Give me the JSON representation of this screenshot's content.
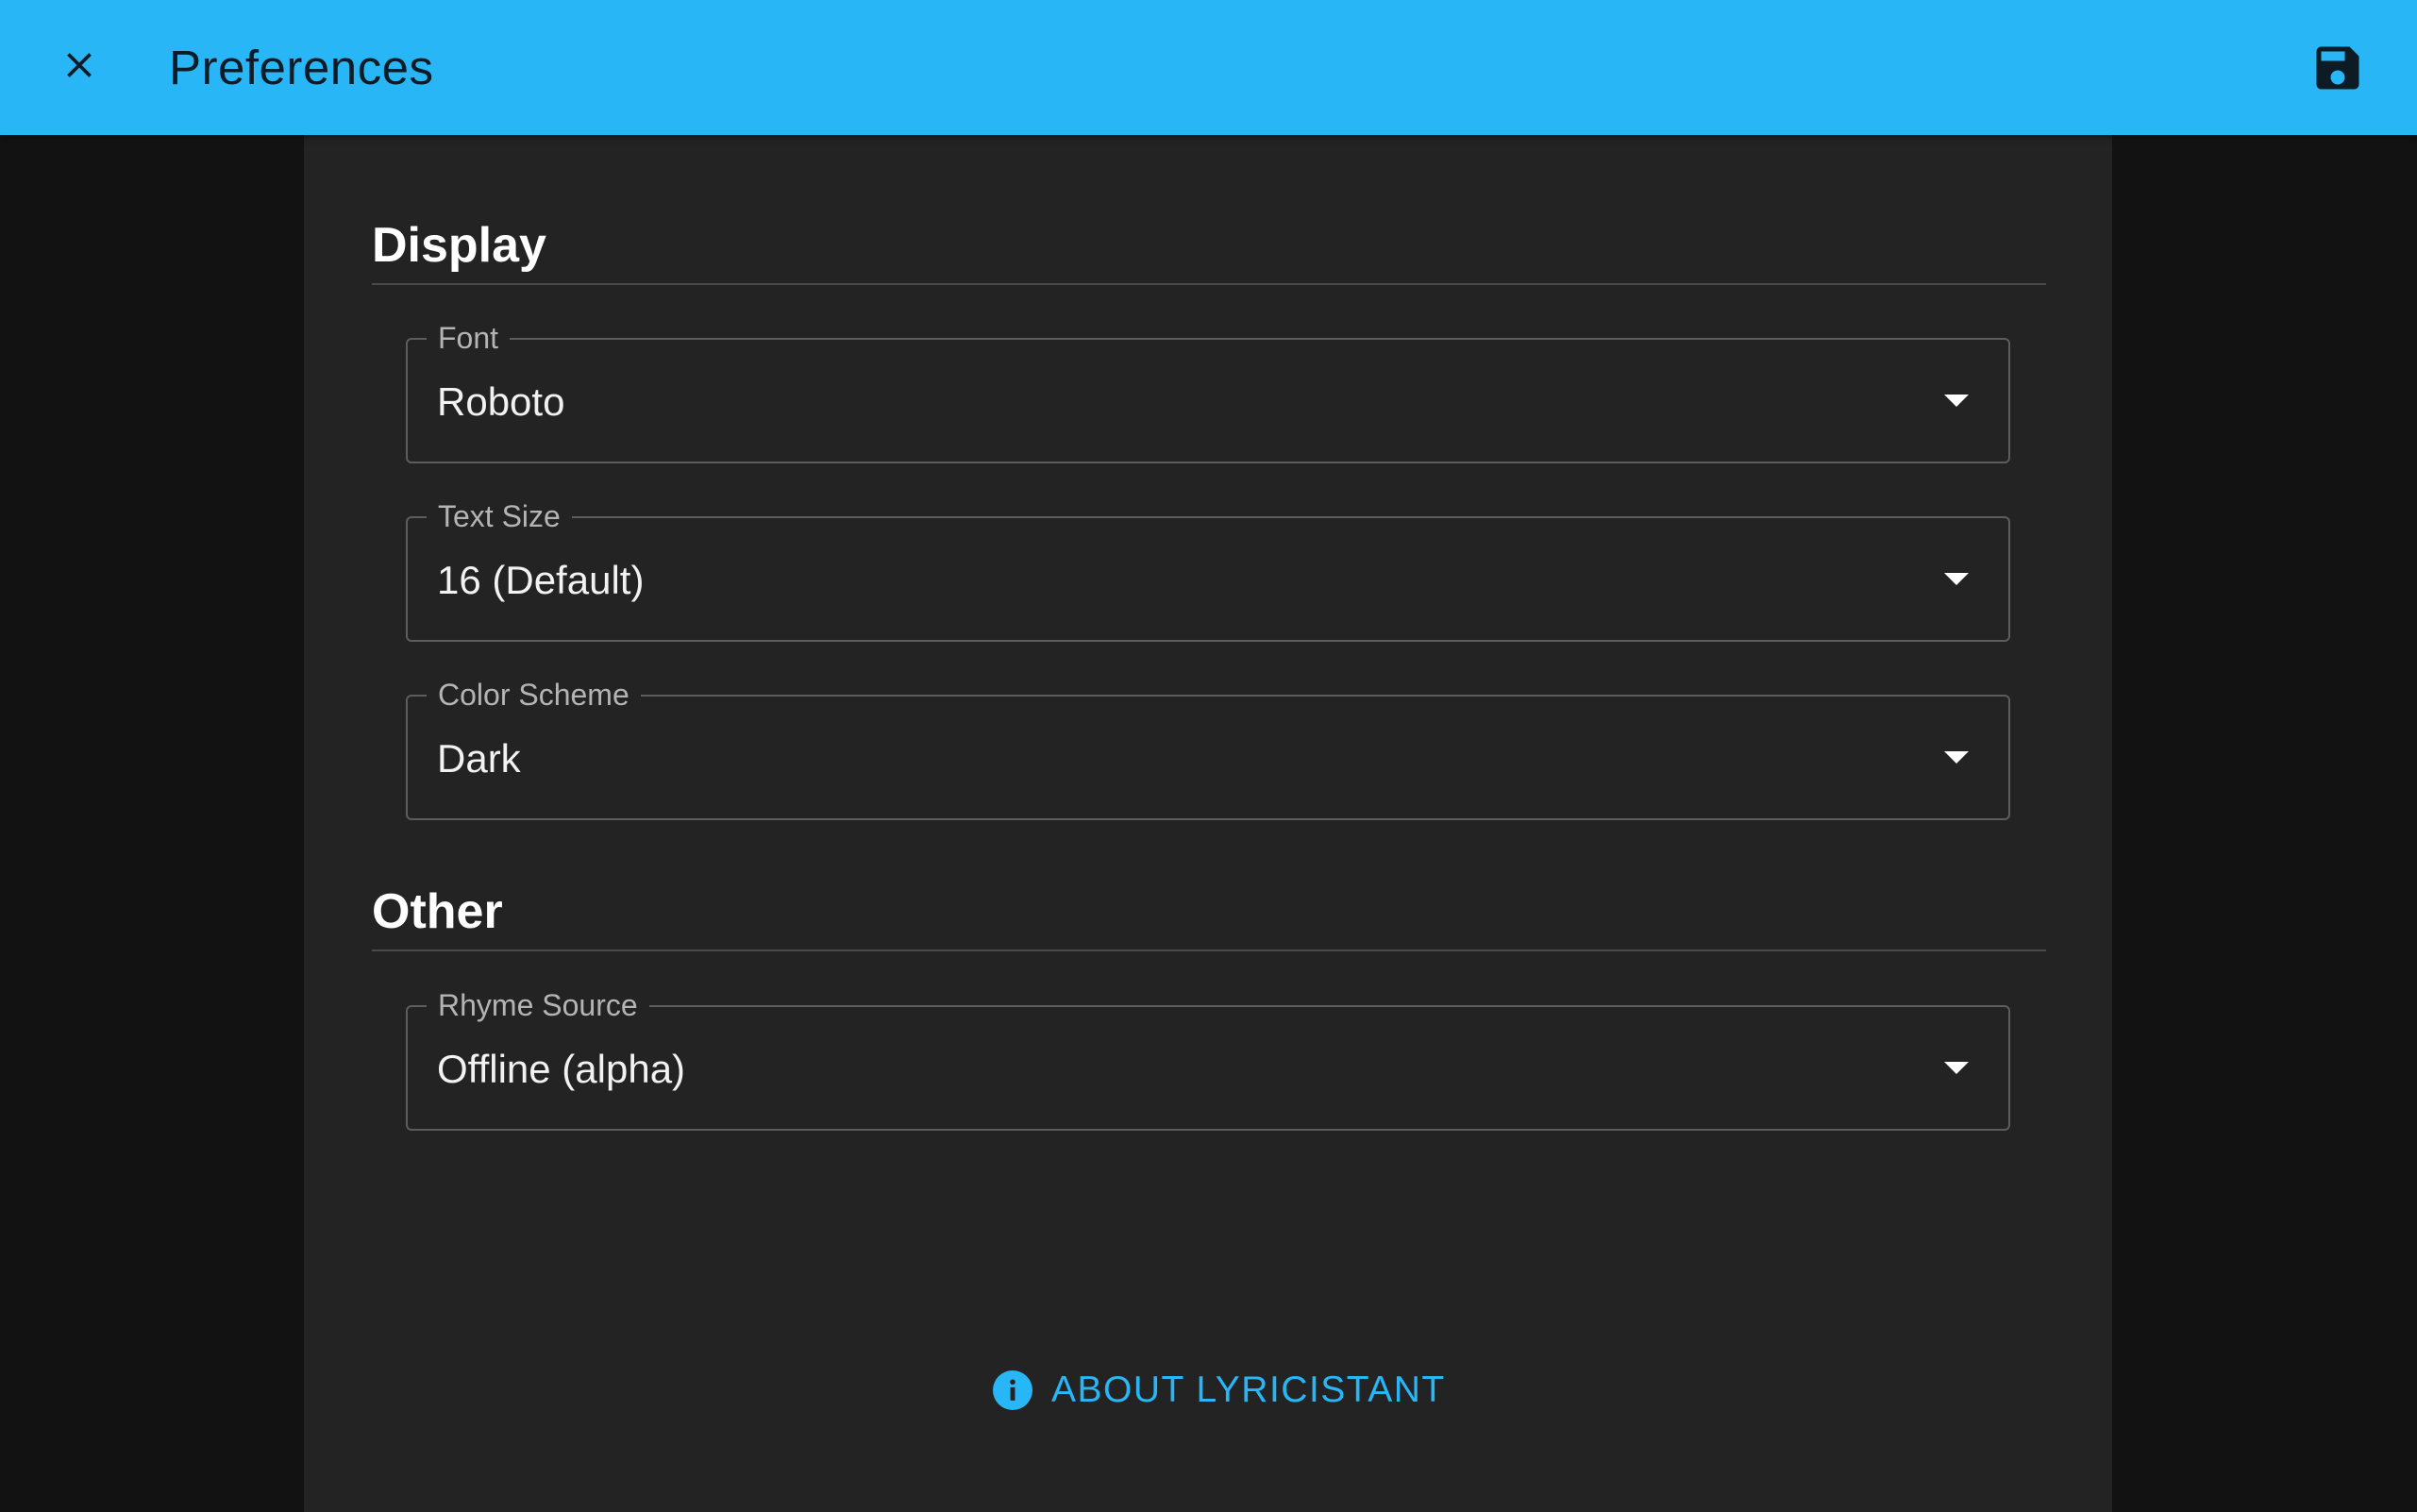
{
  "appbar": {
    "title": "Preferences",
    "close_icon": "close-icon",
    "save_icon": "save-icon",
    "background_color": "#29b6f6"
  },
  "sections": {
    "display": {
      "title": "Display",
      "fields": {
        "font": {
          "label": "Font",
          "value": "Roboto"
        },
        "text_size": {
          "label": "Text Size",
          "value": "16 (Default)"
        },
        "color_scheme": {
          "label": "Color Scheme",
          "value": "Dark"
        }
      }
    },
    "other": {
      "title": "Other",
      "fields": {
        "rhyme_source": {
          "label": "Rhyme Source",
          "value": "Offline (alpha)"
        }
      }
    }
  },
  "about": {
    "label": "ABOUT LYRICISTANT",
    "icon": "info-icon"
  },
  "colors": {
    "accent": "#29b6f6",
    "panel": "#232323",
    "background": "#121212"
  }
}
